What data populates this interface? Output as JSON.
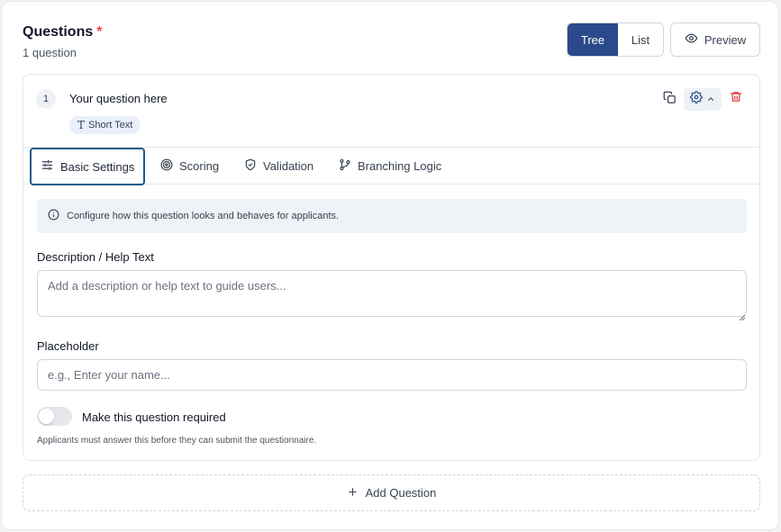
{
  "header": {
    "title": "Questions",
    "required_mark": "*",
    "count_label": "1 question",
    "view_options": [
      "Tree",
      "List"
    ],
    "active_view": "Tree",
    "preview_label": "Preview"
  },
  "question": {
    "number": "1",
    "text": "Your question here",
    "type_label": "Short Text",
    "type_icon": "text-type-icon",
    "actions": [
      "copy-icon",
      "gear-icon",
      "chevron-up-icon",
      "trash-icon"
    ]
  },
  "tabs": [
    {
      "label": "Basic Settings",
      "icon": "sliders-icon",
      "active": true
    },
    {
      "label": "Scoring",
      "icon": "target-icon",
      "active": false
    },
    {
      "label": "Validation",
      "icon": "shield-check-icon",
      "active": false
    },
    {
      "label": "Branching Logic",
      "icon": "git-branch-icon",
      "active": false
    }
  ],
  "basic": {
    "info": "Configure how this question looks and behaves for applicants.",
    "description_label": "Description / Help Text",
    "description_placeholder": "Add a description or help text to guide users...",
    "description_value": "",
    "placeholder_label": "Placeholder",
    "placeholder_placeholder": "e.g., Enter your name...",
    "placeholder_value": "",
    "required_toggle_label": "Make this question required",
    "required_on": false,
    "required_hint": "Applicants must answer this before they can submit the questionnaire."
  },
  "add_question_label": "Add Question",
  "colors": {
    "accent": "#2b4a8b",
    "required": "#ef4444",
    "delete": "#dc2626",
    "tab_focus": "#1e5a85"
  }
}
